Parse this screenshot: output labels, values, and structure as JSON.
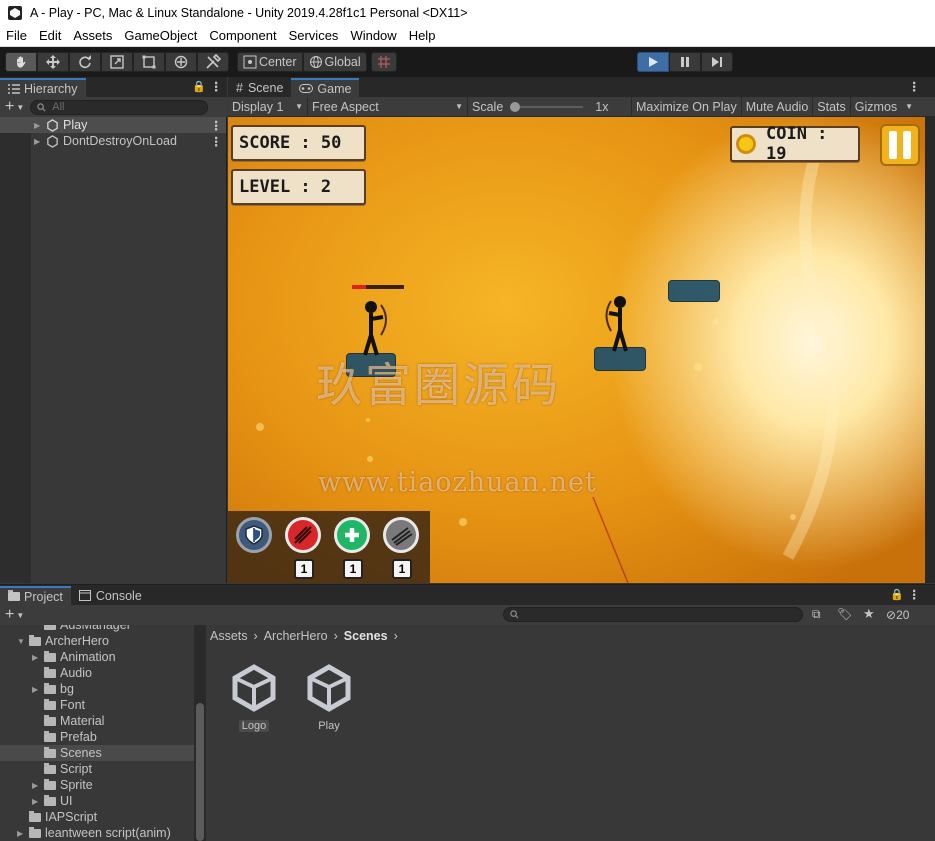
{
  "window": {
    "title": "A - Play - PC, Mac & Linux Standalone - Unity 2019.4.28f1c1 Personal <DX11>"
  },
  "menu": [
    "File",
    "Edit",
    "Assets",
    "GameObject",
    "Component",
    "Services",
    "Window",
    "Help"
  ],
  "toolbar": {
    "pivot": "Center",
    "space": "Global"
  },
  "hierarchy": {
    "tab": "Hierarchy",
    "search_placeholder": "All",
    "rows": [
      {
        "label": "Play",
        "selected": true
      },
      {
        "label": "DontDestroyOnLoad",
        "selected": false
      }
    ]
  },
  "game_panel": {
    "tabs": [
      "Scene",
      "Game"
    ],
    "display": "Display 1",
    "aspect": "Free Aspect",
    "scale_label": "Scale",
    "scale_value": "1x",
    "maximize": "Maximize On Play",
    "mute": "Mute Audio",
    "stats": "Stats",
    "gizmos": "Gizmos"
  },
  "hud": {
    "score": "SCORE : 50",
    "level": "LEVEL : 2",
    "coin": "COIN : 19",
    "skill_counts": [
      "1",
      "1",
      "1"
    ]
  },
  "watermark": {
    "cn": "玖富圈源码",
    "url": "www.tiaozhuan.net"
  },
  "project": {
    "tabs": [
      "Project",
      "Console"
    ],
    "hidden_count": "20",
    "tree": [
      {
        "label": "AdsManager",
        "depth": 2,
        "arrow": ""
      },
      {
        "label": "ArcherHero",
        "depth": 1,
        "arrow": "down"
      },
      {
        "label": "Animation",
        "depth": 2,
        "arrow": "right"
      },
      {
        "label": "Audio",
        "depth": 2,
        "arrow": ""
      },
      {
        "label": "bg",
        "depth": 2,
        "arrow": "right"
      },
      {
        "label": "Font",
        "depth": 2,
        "arrow": ""
      },
      {
        "label": "Material",
        "depth": 2,
        "arrow": ""
      },
      {
        "label": "Prefab",
        "depth": 2,
        "arrow": ""
      },
      {
        "label": "Scenes",
        "depth": 2,
        "arrow": "",
        "selected": true
      },
      {
        "label": "Script",
        "depth": 2,
        "arrow": ""
      },
      {
        "label": "Sprite",
        "depth": 2,
        "arrow": "right"
      },
      {
        "label": "UI",
        "depth": 2,
        "arrow": "right"
      },
      {
        "label": "IAPScript",
        "depth": 1,
        "arrow": ""
      },
      {
        "label": "leantween script(anim)",
        "depth": 1,
        "arrow": "right"
      }
    ],
    "breadcrumb": [
      "Assets",
      "ArcherHero",
      "Scenes"
    ],
    "assets": [
      {
        "label": "Logo",
        "selected": true
      },
      {
        "label": "Play",
        "selected": false
      }
    ]
  }
}
